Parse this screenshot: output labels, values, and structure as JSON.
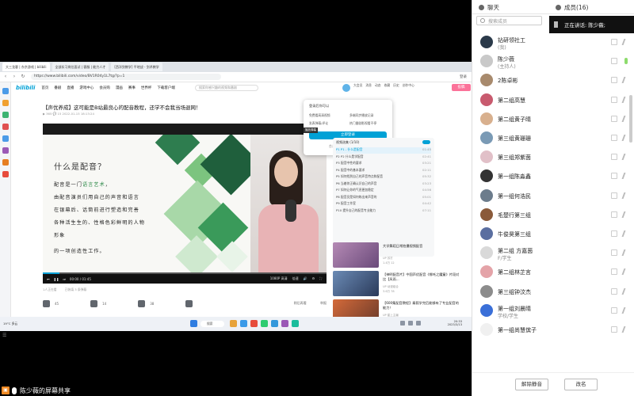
{
  "stage": {
    "tabs": [
      "大三龙客 | 东京游戏 | bilibili",
      "全部实习岗位面试 | 客服 | 能力人才",
      "[西洋剑教学] 平地战 - 剑术教学"
    ],
    "url": "https://www.bilibili.com/video/BV1R04y1L7tg/?p=1",
    "addr_right": "登录",
    "site": {
      "logo": "bilibili",
      "nav": [
        "首页",
        "番剧",
        "直播",
        "游戏中心",
        "会员购",
        "漫画",
        "赛事",
        "世界杯",
        "下载客户端"
      ],
      "search_placeholder": "搜索你感兴趣的视频和番剧",
      "head_icons": [
        "大会员",
        "消息",
        "动态",
        "收藏",
        "历史",
        "创作中心"
      ],
      "upload": "投稿"
    },
    "video": {
      "title": "【声优养成】这可能是B站最良心的配音教程，还学不会我当场退网！",
      "meta": "▶ 365   💬 15   2022-01-15 18:13:24",
      "slide_title": "什么是配音？",
      "slide_lines": [
        {
          "before": "配音是一门",
          "hl": "语言艺术",
          "after": "，"
        },
        {
          "before": "由配音演员们用自己的声音和语言",
          "hl": "",
          "after": ""
        },
        {
          "before": "在银幕后、话筒前进行塑造和完善",
          "hl": "",
          "after": ""
        },
        {
          "before": "各种活生生的、性格色彩鲜明的人物",
          "hl": "",
          "after": ""
        },
        {
          "before": "形象",
          "hl": "",
          "after": ""
        },
        {
          "before": "的一项创造性工作。",
          "hl": "",
          "after": ""
        }
      ],
      "time": "00:00 / 01:45",
      "quality": "1080P 高清",
      "speed": "倍速",
      "progress": 0.06,
      "stats_line": [
        "1人正在看",
        "已装填 3 条弹幕"
      ],
      "actions": [
        "45",
        "14",
        "38",
        ""
      ],
      "share_right": [
        "稍后再看",
        "举报"
      ]
    },
    "popup": {
      "title": "登录后你可以",
      "options": [
        "免费看高清视频",
        "多端同步播放记录",
        "发表弹幕/评论",
        "热门番剧影视看不停"
      ],
      "tip": "播放弹幕",
      "login": "立即登录",
      "register_prefix": "首次使用？",
      "register_link": "点我注册"
    },
    "playlist": {
      "header": "视频选集 (1/10)",
      "items": [
        {
          "label": "P1  P1 - 什么是配音",
          "time": "01:45"
        },
        {
          "label": "P2  P2 什么是学配音",
          "time": "02:41"
        },
        {
          "label": "P3  配音中性的要求",
          "time": "03:21"
        },
        {
          "label": "P4  配音中的基本要求",
          "time": "02:11"
        },
        {
          "label": "P5  如何找到自己的声音特点和配音",
          "time": "05:32"
        },
        {
          "label": "P6  当着你正确认识自己的声音",
          "time": "03:23"
        },
        {
          "label": "P7  如何让你的气息更加稳定",
          "time": "04:56"
        },
        {
          "label": "P8  配音员是如何练出来声音的",
          "time": "05:01"
        },
        {
          "label": "P9  配音工作室",
          "time": "04:42"
        },
        {
          "label": "P10  提升自己的配音专业能力",
          "time": "07:11"
        }
      ]
    },
    "recs": [
      {
        "title": "大学舞蹈日常拍摄视频配音",
        "author": "UP 苏打",
        "stats": "1.4万  12"
      },
      {
        "title": "【神明配音片】中国声优配音《哪吒之魔童》片段对比【风雨...",
        "author": "UP 动漫组合",
        "stats": "3.6万  78"
      },
      {
        "title": "【600集配音教程】秦毅学完后能够有了专业配音的能力！",
        "author": "UP 星上主编",
        "stats": "8.8万  143"
      }
    ],
    "taskbar": {
      "weather": "19°C 多云",
      "search": "搜索",
      "clock_time": "20:33",
      "clock_date": "2023/3/13"
    },
    "caption": "陈少薇的屏幕共享"
  },
  "panel": {
    "chat_tab": "聊天",
    "members_tab": "成员(16)",
    "speaking": "正在讲话: 陈少薇;",
    "search_placeholder": "搜索成员",
    "members": [
      {
        "name": "钻研领社工",
        "sub": "(我)",
        "color": "#2b3a4a",
        "mic": "off"
      },
      {
        "name": "陈少薇",
        "sub": "(主持人)",
        "color": "#c9c9c9",
        "mic": "on"
      },
      {
        "name": "2陈卓彬",
        "sub": "",
        "color": "#a88a6d",
        "mic": "off"
      },
      {
        "name": "第二组高慧",
        "sub": "",
        "color": "#c85a6e",
        "mic": "off"
      },
      {
        "name": "第二组黄子晴",
        "sub": "",
        "color": "#d8b08e",
        "mic": "off"
      },
      {
        "name": "第三组黄珊珊",
        "sub": "",
        "color": "#7a9ab5",
        "mic": "off"
      },
      {
        "name": "第三组郑紫茵",
        "sub": "",
        "color": "#e1c0c8",
        "mic": "off"
      },
      {
        "name": "第一组陈淼鑫",
        "sub": "",
        "color": "#333333",
        "mic": "off"
      },
      {
        "name": "第一组何浩民",
        "sub": "",
        "color": "#6c7c8c",
        "mic": "off"
      },
      {
        "name": "毛楚行第三组",
        "sub": "",
        "color": "#8a5a3a",
        "mic": "off"
      },
      {
        "name": "牛俊昊第三组",
        "sub": "",
        "color": "#5a6ea0",
        "mic": "off"
      },
      {
        "name": "第二组 方嘉茵",
        "sub": "F/学生",
        "color": "#d9d9d9",
        "mic": "off"
      },
      {
        "name": "第二组林芷言",
        "sub": "",
        "color": "#e4a3a8",
        "mic": "off"
      },
      {
        "name": "第三组钟汶杰",
        "sub": "",
        "color": "#8c8c8c",
        "mic": "off"
      },
      {
        "name": "第一组刘晨晴",
        "sub": "学校/学生",
        "color": "#3a6fd8",
        "mic": "off"
      },
      {
        "name": "第一组尚慧傧子",
        "sub": "",
        "color": "#f0f0f0",
        "mic": "off"
      }
    ],
    "mute_all": "解除静音",
    "rename": "改名"
  }
}
